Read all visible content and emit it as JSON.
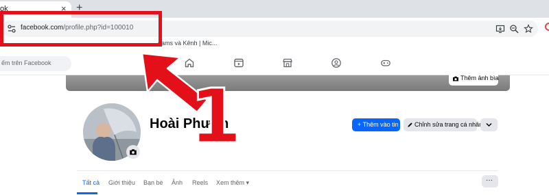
{
  "browser": {
    "tab_title": "ok",
    "tab_close": "×",
    "new_tab": "+",
    "url_host": "facebook.com",
    "url_path": "/profile.php?id=100010",
    "bookmark_text": "eams và Kênh | Mic..."
  },
  "facebook": {
    "search_placeholder": "ếm trên Facebook",
    "cover_button_label": "Thêm ảnh bìa",
    "profile_name": "Hoài Phươn",
    "add_story_label": "+ Thêm vào tin",
    "edit_profile_label": "Chỉnh sửa trang cá nhân",
    "more_caret": "⌄",
    "profile_tabs": [
      "Tất cả",
      "Giới thiệu",
      "Bạn bè",
      "Ảnh",
      "Reels",
      "Xem thêm ▾"
    ],
    "tabs_more": "···"
  },
  "annotation": {
    "step_number": "1",
    "color": "#e3101a"
  },
  "colors": {
    "fb_blue": "#0866ff",
    "button_gray": "#e4e6eb"
  }
}
